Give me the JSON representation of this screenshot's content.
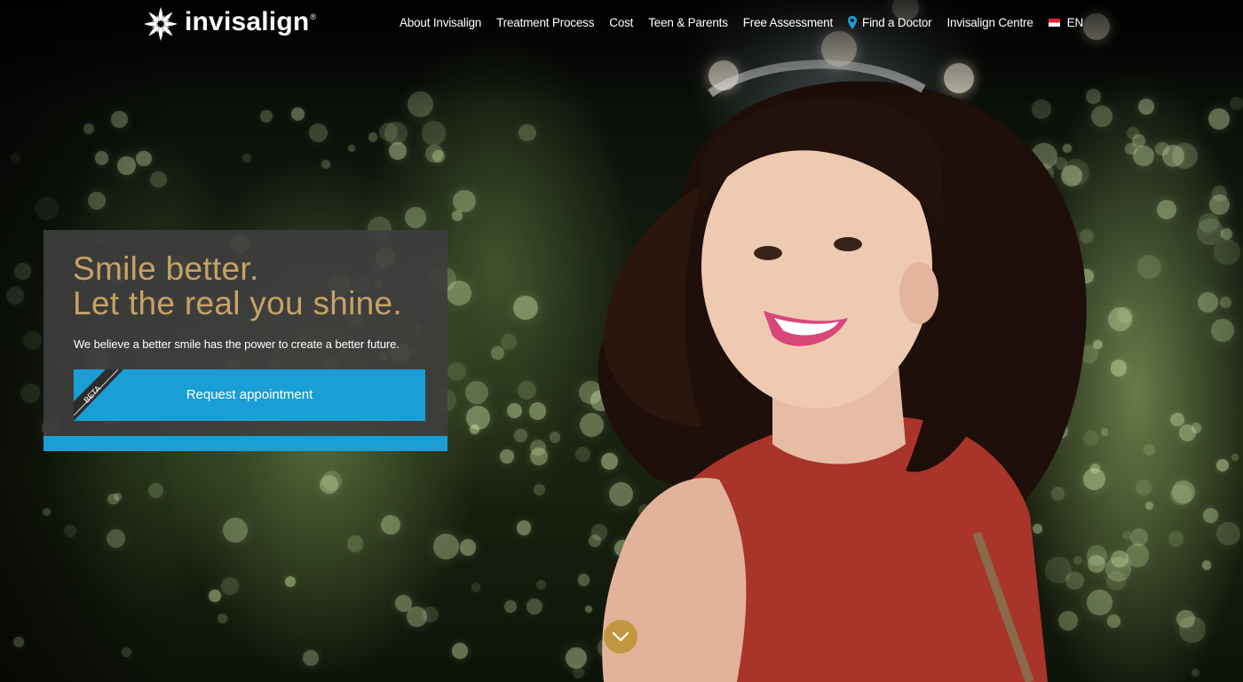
{
  "brand": {
    "name": "invisalign",
    "registered": "®",
    "logo_icon": "starburst-logo-icon"
  },
  "nav": {
    "items": [
      {
        "label": "About Invisalign"
      },
      {
        "label": "Treatment Process"
      },
      {
        "label": "Cost"
      },
      {
        "label": "Teen & Parents"
      },
      {
        "label": "Free Assessment"
      },
      {
        "label": "Find a Doctor",
        "icon": "map-pin-icon"
      },
      {
        "label": "Invisalign Centre"
      },
      {
        "label": "EN",
        "icon": "singapore-flag-icon"
      }
    ]
  },
  "hero": {
    "headline_line1": "Smile better.",
    "headline_line2": "Let the real you shine.",
    "subtext": "We believe a better smile has the power to create a better future.",
    "cta_label": "Request appointment",
    "cta_badge": "BETA",
    "scroll_icon": "chevron-down-icon"
  },
  "colors": {
    "accent_blue": "#199fd6",
    "gold": "#c8a165",
    "card_bg": "#3e3e3e",
    "scroll_button": "#c3973f"
  }
}
